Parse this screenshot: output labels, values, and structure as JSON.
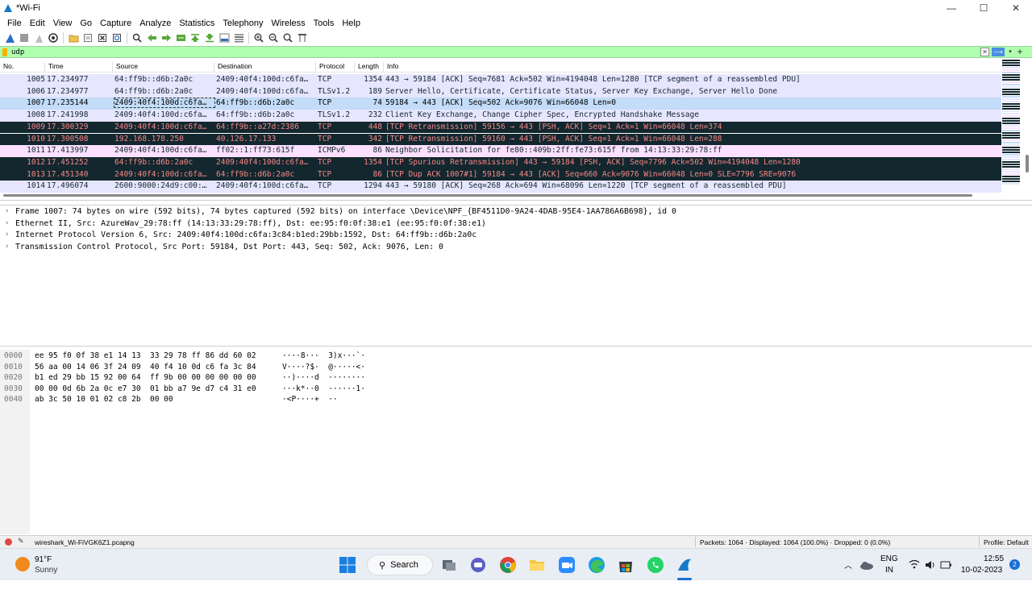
{
  "window": {
    "title": "*Wi-Fi",
    "controls": {
      "minimize": "—",
      "maximize": "☐",
      "close": "✕"
    }
  },
  "menu": [
    "File",
    "Edit",
    "View",
    "Go",
    "Capture",
    "Analyze",
    "Statistics",
    "Telephony",
    "Wireless",
    "Tools",
    "Help"
  ],
  "toolbar": {
    "icons": [
      "shark-start-icon",
      "stop-icon",
      "restart-icon",
      "options-icon",
      "open-file-icon",
      "save-file-icon",
      "close-file-icon",
      "reload-icon",
      "find-icon",
      "go-back-icon",
      "go-forward-icon",
      "go-to-packet-icon",
      "first-packet-icon",
      "last-packet-icon",
      "autoscroll-icon",
      "colorize-icon",
      "zoom-in-icon",
      "zoom-out-icon",
      "zoom-reset-icon",
      "resize-columns-icon"
    ]
  },
  "filter": {
    "value": "udp",
    "accent": "#afffaf"
  },
  "packet_list": {
    "columns": [
      "No.",
      "Time",
      "Source",
      "Destination",
      "Protocol",
      "Length",
      "Info"
    ],
    "rows": [
      {
        "no": "1005",
        "time": "17.234977",
        "src": "64:ff9b::d6b:2a0c",
        "dst": "2409:40f4:100d:c6fa…",
        "proto": "TCP",
        "len": "1354",
        "info": "443 → 59184 [ACK] Seq=7681 Ack=502 Win=4194048 Len=1280 [TCP segment of a reassembled PDU]",
        "style": "tcp"
      },
      {
        "no": "1006",
        "time": "17.234977",
        "src": "64:ff9b::d6b:2a0c",
        "dst": "2409:40f4:100d:c6fa…",
        "proto": "TLSv1.2",
        "len": "189",
        "info": "Server Hello, Certificate, Certificate Status, Server Key Exchange, Server Hello Done",
        "style": "tcp"
      },
      {
        "no": "1007",
        "time": "17.235144",
        "src": "2409:40f4:100d:c6fa…",
        "dst": "64:ff9b::d6b:2a0c",
        "proto": "TCP",
        "len": "74",
        "info": "59184 → 443 [ACK] Seq=502 Ack=9076 Win=66048 Len=0",
        "style": "sel"
      },
      {
        "no": "1008",
        "time": "17.241998",
        "src": "2409:40f4:100d:c6fa…",
        "dst": "64:ff9b::d6b:2a0c",
        "proto": "TLSv1.2",
        "len": "232",
        "info": "Client Key Exchange, Change Cipher Spec, Encrypted Handshake Message",
        "style": "tcp"
      },
      {
        "no": "1009",
        "time": "17.300329",
        "src": "2409:40f4:100d:c6fa…",
        "dst": "64:ff9b::a27d:2386",
        "proto": "TCP",
        "len": "448",
        "info": "[TCP Retransmission] 59156 → 443 [PSH, ACK] Seq=1 Ack=1 Win=66048 Len=374",
        "style": "bad"
      },
      {
        "no": "1010",
        "time": "17.300508",
        "src": "192.168.178.250",
        "dst": "40.126.17.133",
        "proto": "TCP",
        "len": "342",
        "info": "[TCP Retransmission] 59160 → 443 [PSH, ACK] Seq=1 Ack=1 Win=66048 Len=288",
        "style": "bad"
      },
      {
        "no": "1011",
        "time": "17.413997",
        "src": "2409:40f4:100d:c6fa…",
        "dst": "ff02::1:ff73:615f",
        "proto": "ICMPv6",
        "len": "86",
        "info": "Neighbor Solicitation for fe80::409b:2ff:fe73:615f from 14:13:33:29:78:ff",
        "style": "icmp"
      },
      {
        "no": "1012",
        "time": "17.451252",
        "src": "64:ff9b::d6b:2a0c",
        "dst": "2409:40f4:100d:c6fa…",
        "proto": "TCP",
        "len": "1354",
        "info": "[TCP Spurious Retransmission] 443 → 59184 [PSH, ACK] Seq=7796 Ack=502 Win=4194048 Len=1280",
        "style": "bad"
      },
      {
        "no": "1013",
        "time": "17.451340",
        "src": "2409:40f4:100d:c6fa…",
        "dst": "64:ff9b::d6b:2a0c",
        "proto": "TCP",
        "len": "86",
        "info": "[TCP Dup ACK 1007#1] 59184 → 443 [ACK] Seq=660 Ack=9076 Win=66048 Len=0 SLE=7796 SRE=9076",
        "style": "bad"
      },
      {
        "no": "1014",
        "time": "17.496074",
        "src": "2600:9000:24d9:c00:…",
        "dst": "2409:40f4:100d:c6fa…",
        "proto": "TCP",
        "len": "1294",
        "info": "443 → 59180 [ACK] Seq=268 Ack=694 Win=68096 Len=1220 [TCP segment of a reassembled PDU]",
        "style": "tcp"
      }
    ]
  },
  "details": [
    "Frame 1007: 74 bytes on wire (592 bits), 74 bytes captured (592 bits) on interface \\Device\\NPF_{BF4511D0-9A24-4DAB-95E4-1AA786A6B698}, id 0",
    "Ethernet II, Src: AzureWav_29:78:ff (14:13:33:29:78:ff), Dst: ee:95:f0:0f:38:e1 (ee:95:f0:0f:38:e1)",
    "Internet Protocol Version 6, Src: 2409:40f4:100d:c6fa:3c84:b1ed:29bb:1592, Dst: 64:ff9b::d6b:2a0c",
    "Transmission Control Protocol, Src Port: 59184, Dst Port: 443, Seq: 502, Ack: 9076, Len: 0"
  ],
  "bytes": [
    {
      "off": "0000",
      "hex": "ee 95 f0 0f 38 e1 14 13  33 29 78 ff 86 dd 60 02",
      "asc": "····8···  3)x···`·"
    },
    {
      "off": "0010",
      "hex": "56 aa 00 14 06 3f 24 09  40 f4 10 0d c6 fa 3c 84",
      "asc": "V····?$·  @·····<·"
    },
    {
      "off": "0020",
      "hex": "b1 ed 29 bb 15 92 00 64  ff 9b 00 00 00 00 00 00",
      "asc": "··)····d  ········"
    },
    {
      "off": "0030",
      "hex": "00 00 0d 6b 2a 0c e7 30  01 bb a7 9e d7 c4 31 e0",
      "asc": "···k*··0  ······1·"
    },
    {
      "off": "0040",
      "hex": "ab 3c 50 10 01 02 c8 2b  00 00",
      "asc": "·<P····+  ··"
    }
  ],
  "status": {
    "file": "wireshark_Wi-FiVGK6Z1.pcapng",
    "packets": "Packets: 1064 · Displayed: 1064 (100.0%) · Dropped: 0 (0.0%)",
    "profile": "Profile: Default"
  },
  "taskbar": {
    "weather_temp": "91°F",
    "weather_desc": "Sunny",
    "search_label": "Search",
    "lang_top": "ENG",
    "lang_bottom": "IN",
    "time": "12:55",
    "date": "10-02-2023",
    "notification_count": "2"
  }
}
